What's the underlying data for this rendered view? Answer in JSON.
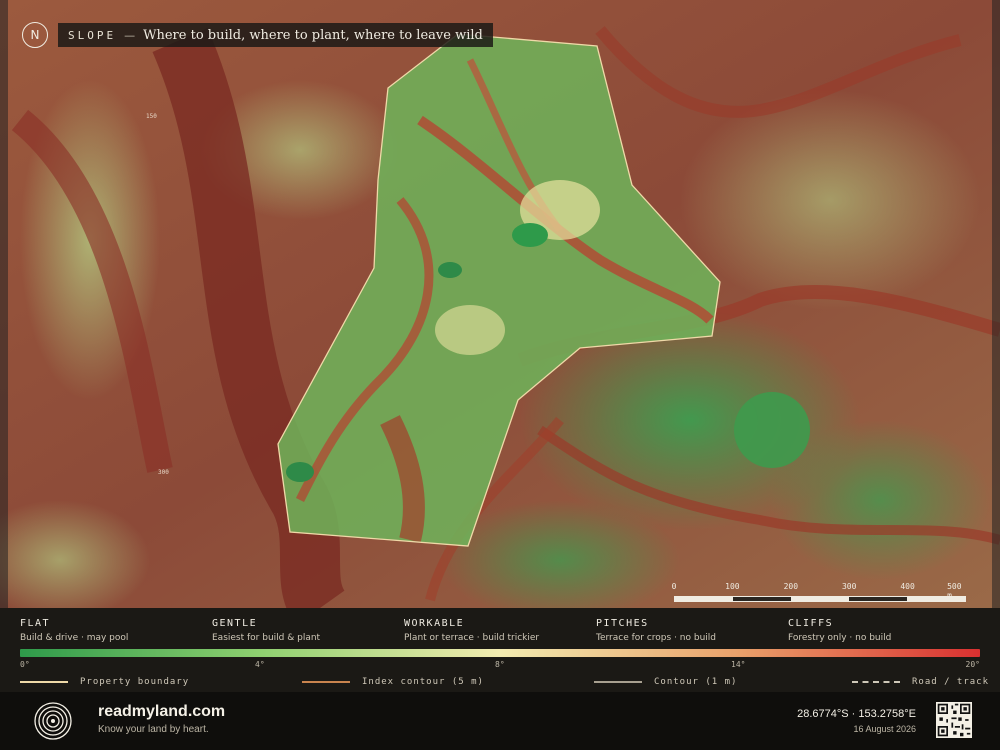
{
  "map": {
    "north_label": "N",
    "title_key": "SLOPE",
    "title_dash": "—",
    "title_sub": "Where to build, where to plant, where to leave wild",
    "scale": {
      "ticks": [
        "0",
        "100",
        "200",
        "300",
        "400",
        "500 m"
      ]
    },
    "contour_labels": [
      "150",
      "300"
    ]
  },
  "legend": {
    "classes": [
      {
        "name": "FLAT",
        "desc": "Build & drive · may pool"
      },
      {
        "name": "GENTLE",
        "desc": "Easiest for build & plant"
      },
      {
        "name": "WORKABLE",
        "desc": "Plant or terrace · build trickier"
      },
      {
        "name": "PITCHES",
        "desc": "Terrace for crops · no build"
      },
      {
        "name": "CLIFFS",
        "desc": "Forestry only · no build"
      }
    ],
    "ticks": [
      "0°",
      "4°",
      "8°",
      "14°",
      "20°"
    ],
    "lines": [
      {
        "label": "Property boundary",
        "color": "#efd9a8",
        "style": "solid"
      },
      {
        "label": "Index contour (5 m)",
        "color": "#c9844e",
        "style": "solid"
      },
      {
        "label": "Contour (1 m)",
        "color": "#a8a090",
        "style": "solid"
      },
      {
        "label": "Road / track",
        "color": "#cfc8b8",
        "style": "dashed"
      }
    ],
    "colors": {
      "flat": "#2e9a4a",
      "gentle": "#8fd070",
      "workable": "#f2ebb0",
      "pitches": "#e9a06a",
      "cliffs": "#d93030"
    }
  },
  "footer": {
    "brand": "readmyland.com",
    "tagline": "Know your land by heart.",
    "coords": "28.6774°S · 153.2758°E",
    "date": "16 August 2026"
  }
}
